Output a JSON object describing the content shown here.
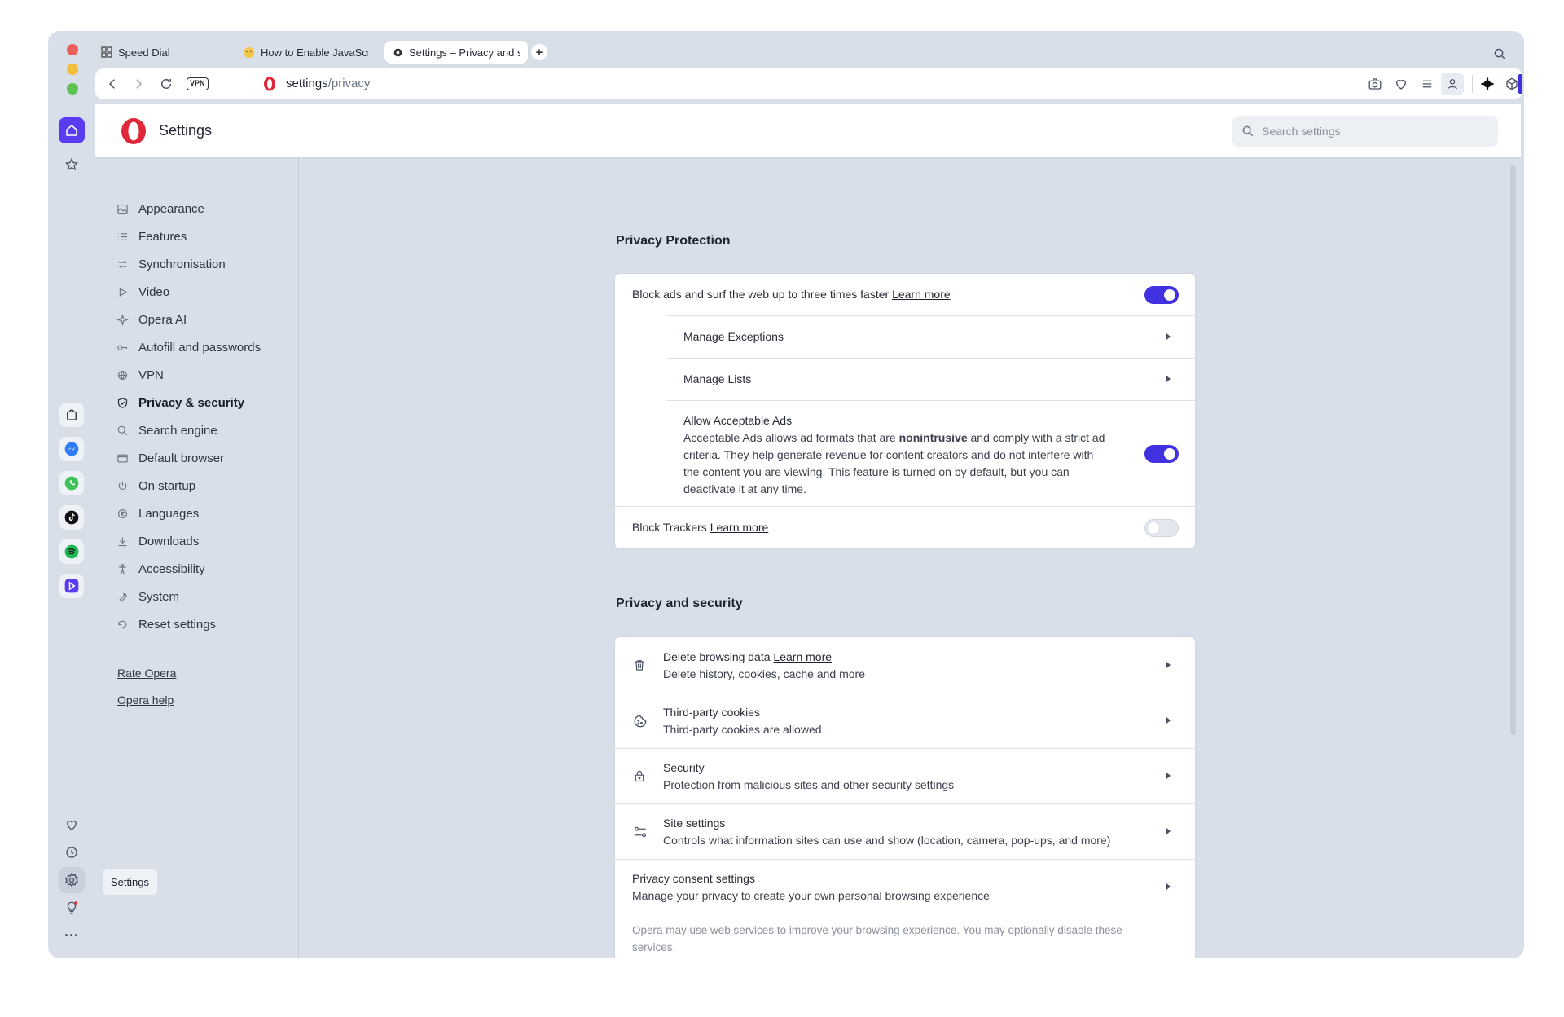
{
  "tabs": [
    {
      "label": "Speed Dial",
      "icon": "grid-icon"
    },
    {
      "label": "How to Enable JavaScrip",
      "icon": "emoji-icon"
    },
    {
      "label": "Settings – Privacy and s",
      "icon": "gear-icon"
    }
  ],
  "address": {
    "host": "settings",
    "path": "/privacy",
    "vpn_label": "VPN"
  },
  "header": {
    "title": "Settings",
    "search_placeholder": "Search settings"
  },
  "sidebar": {
    "items": [
      {
        "label": "Appearance",
        "icon": "image-icon"
      },
      {
        "label": "Features",
        "icon": "list-icon"
      },
      {
        "label": "Synchronisation",
        "icon": "sync-icon"
      },
      {
        "label": "Video",
        "icon": "play-icon"
      },
      {
        "label": "Opera AI",
        "icon": "sparkle-icon"
      },
      {
        "label": "Autofill and passwords",
        "icon": "key-icon"
      },
      {
        "label": "VPN",
        "icon": "globe-icon"
      },
      {
        "label": "Privacy & security",
        "icon": "shield-icon",
        "active": true
      },
      {
        "label": "Search engine",
        "icon": "search-icon"
      },
      {
        "label": "Default browser",
        "icon": "browser-icon"
      },
      {
        "label": "On startup",
        "icon": "power-icon"
      },
      {
        "label": "Languages",
        "icon": "language-icon"
      },
      {
        "label": "Downloads",
        "icon": "download-icon"
      },
      {
        "label": "Accessibility",
        "icon": "accessibility-icon"
      },
      {
        "label": "System",
        "icon": "wrench-icon"
      },
      {
        "label": "Reset settings",
        "icon": "reset-icon"
      }
    ],
    "footer": {
      "rate": "Rate Opera",
      "help": "Opera help"
    }
  },
  "privacy_protection": {
    "title": "Privacy Protection",
    "block_ads": {
      "label": "Block ads and surf the web up to three times faster",
      "link": "Learn more",
      "enabled": true
    },
    "manage_exceptions": "Manage Exceptions",
    "manage_lists": "Manage Lists",
    "acceptable_ads": {
      "title": "Allow Acceptable Ads",
      "desc_line1_a": "Acceptable Ads allows ad formats that are ",
      "desc_bold": "nonintrusive",
      "desc_line1_b": " and comply with a strict ad",
      "desc_line2": "criteria. They help generate revenue for content creators and do not interfere with",
      "desc_line3": "the content you are viewing. This feature is turned on by default, but you can",
      "desc_line4": "deactivate it at any time.",
      "enabled": true
    },
    "block_trackers": {
      "label": "Block Trackers",
      "link": "Learn more",
      "enabled": false
    }
  },
  "privacy_security": {
    "title": "Privacy and security",
    "rows": [
      {
        "title": "Delete browsing data",
        "link": "Learn more",
        "subtitle": "Delete history, cookies, cache and more",
        "icon": "trash-icon"
      },
      {
        "title": "Third-party cookies",
        "subtitle": "Third-party cookies are allowed",
        "icon": "cookie-icon"
      },
      {
        "title": "Security",
        "subtitle": "Protection from malicious sites and other security settings",
        "icon": "lock-icon"
      },
      {
        "title": "Site settings",
        "subtitle": "Controls what information sites can use and show (location, camera, pop-ups, and more)",
        "icon": "sliders-icon"
      },
      {
        "title": "Privacy consent settings",
        "subtitle": "Manage your privacy to create your own personal browsing experience"
      }
    ],
    "note_line1": "Opera may use web services to improve your browsing experience. You may optionally disable these",
    "note_line2": "services."
  },
  "tooltip": "Settings",
  "colors": {
    "accent": "#4231e0",
    "home": "#5a3cf0",
    "frame": "#d8dfe9"
  }
}
